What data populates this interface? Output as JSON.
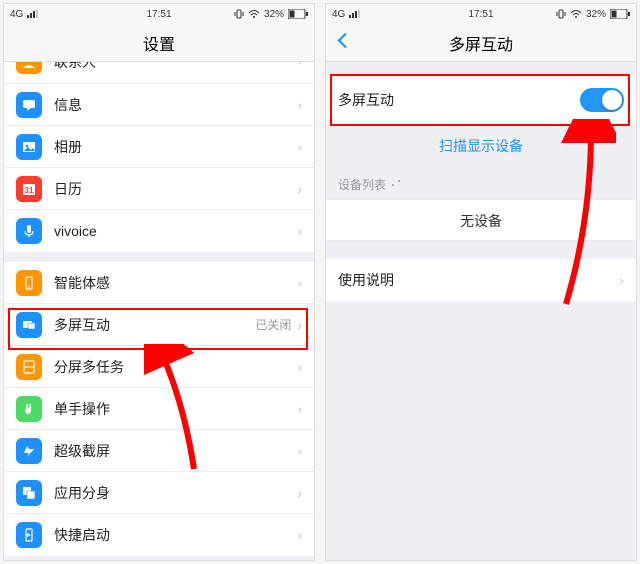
{
  "status": {
    "network": "4G",
    "time": "17:51",
    "battery_pct": "32%"
  },
  "left": {
    "title": "设置",
    "rows": {
      "contacts": "联系人",
      "messages": "信息",
      "photos": "相册",
      "calendar": "日历",
      "vivoice": "vivoice",
      "smartmotion": "智能体感",
      "multiscreen": "多屏互动",
      "multiscreen_status": "已关闭",
      "splitscreen": "分屏多任务",
      "onehanded": "单手操作",
      "supercapture": "超级截屏",
      "appclone": "应用分身",
      "quickstart": "快捷启动"
    }
  },
  "right": {
    "title": "多屏互动",
    "toggle_label": "多屏互动",
    "scan": "扫描显示设备",
    "device_list_header": "设备列表",
    "no_device": "无设备",
    "instructions": "使用说明"
  },
  "icon_colors": {
    "contacts": "#ff9500",
    "messages": "#1e90ff",
    "photos": "#1e90ff",
    "calendar": "#ff3b30",
    "vivoice": "#1e90ff",
    "smartmotion": "#ff9500",
    "multiscreen": "#1e90ff",
    "splitscreen": "#ff9500",
    "onehanded": "#4cd964",
    "supercapture": "#1e90ff",
    "appclone": "#1e90ff",
    "quickstart": "#1e90ff"
  }
}
